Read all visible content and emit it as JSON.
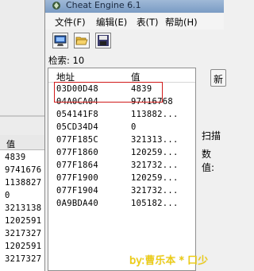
{
  "window": {
    "title": "Cheat Engine 6.1"
  },
  "menu": [
    "文件(F)",
    "编辑(E)",
    "表(T)",
    "帮助(H)"
  ],
  "toolbar": {
    "buttons": [
      "process-select",
      "open",
      "save"
    ]
  },
  "found": {
    "label": "检索: 10"
  },
  "columns": {
    "address": "地址",
    "value": "值"
  },
  "rows": [
    {
      "address": "03D00D48",
      "value": "4839"
    },
    {
      "address": "04A0CA04",
      "value": "97416768"
    },
    {
      "address": "054141F8",
      "value": "113882..."
    },
    {
      "address": "05CD34D4",
      "value": "0"
    },
    {
      "address": "077F185C",
      "value": "321313..."
    },
    {
      "address": "077F1860",
      "value": "120259..."
    },
    {
      "address": "077F1864",
      "value": "321732..."
    },
    {
      "address": "077F1900",
      "value": "120259..."
    },
    {
      "address": "077F1904",
      "value": "321732..."
    },
    {
      "address": "0A9BDA40",
      "value": "105182..."
    }
  ],
  "side": {
    "scan_label": "扫描",
    "value_label": "数值:",
    "new_button": "新"
  },
  "background_list": {
    "header": "值",
    "values": [
      "4839",
      "9741676",
      "1138827",
      "0",
      "3213138",
      "1202591",
      "3217327",
      "1202591",
      "3217327"
    ]
  },
  "watermark": "by:曹乐本 * 口少",
  "colors": {
    "highlight": "#d01a1a",
    "title_gradient": "#8aaacf",
    "watermark": "#f4d000"
  }
}
